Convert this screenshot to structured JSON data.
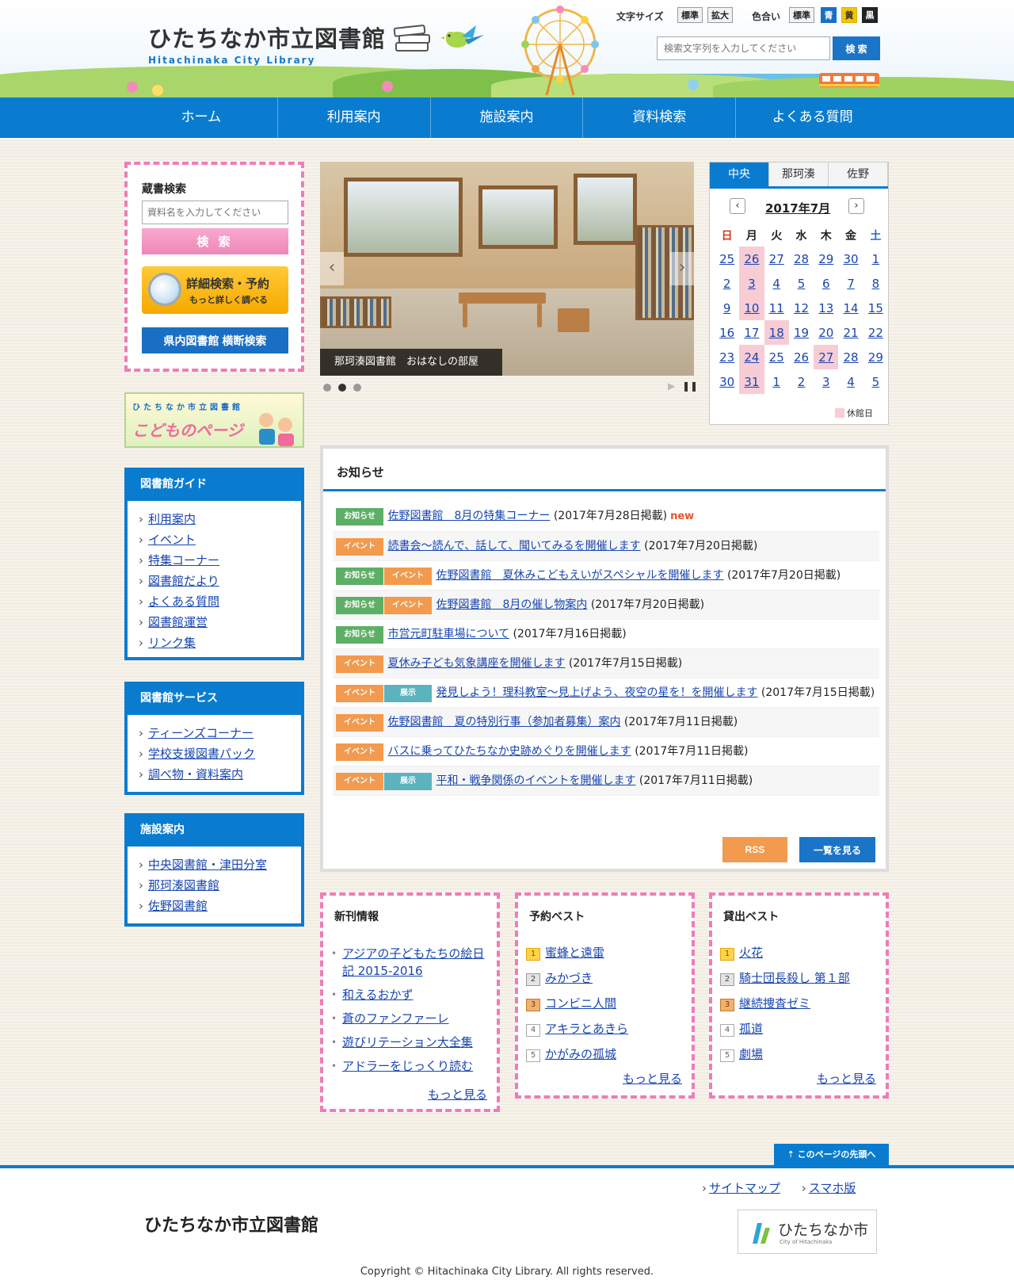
{
  "header": {
    "title": "ひたちなか市立図書館",
    "subtitle": "Hitachinaka City Library",
    "font_size_label": "文字サイズ",
    "font_size_options": [
      "標準",
      "拡大"
    ],
    "color_label": "色合い",
    "color_options": [
      "標準",
      "青",
      "黄",
      "黒"
    ],
    "search_placeholder": "検索文字列を入力してください",
    "search_button": "検 索"
  },
  "nav": {
    "items": [
      "ホーム",
      "利用案内",
      "施設案内",
      "資料検索",
      "よくある質問"
    ]
  },
  "catalog": {
    "heading": "蔵書検索",
    "placeholder": "資料名を入力してください",
    "search_button": "検 索",
    "detail_title": "詳細検索・予約",
    "detail_sub": "もっと詳しく調べる",
    "pref_button": "県内図書館 横断検索"
  },
  "kids_banner": {
    "line1": "ひたちなか市立図書館",
    "line2": "こどものページ"
  },
  "guide": {
    "heading": "図書館ガイド",
    "items": [
      "利用案内",
      "イベント",
      "特集コーナー",
      "図書館だより",
      "よくある質問",
      "図書館運営",
      "リンク集"
    ]
  },
  "services": {
    "heading": "図書館サービス",
    "items": [
      "ティーンズコーナー",
      "学校支援図書パック",
      "調べ物・資料案内"
    ]
  },
  "facilities": {
    "heading": "施設案内",
    "items": [
      "中央図書館・津田分室",
      "那珂湊図書館",
      "佐野図書館"
    ]
  },
  "slideshow": {
    "caption": "那珂湊図書館　おはなしの部屋",
    "prev": "‹",
    "next": "›",
    "play": "▶",
    "pause": "❚❚"
  },
  "calendar": {
    "tabs": [
      "中央",
      "那珂湊",
      "佐野"
    ],
    "month": "2017年7月",
    "prev": "‹",
    "next": "›",
    "weekdays": [
      "日",
      "月",
      "火",
      "水",
      "木",
      "金",
      "土"
    ],
    "weeks": [
      [
        "25",
        "26",
        "27",
        "28",
        "29",
        "30",
        "1"
      ],
      [
        "2",
        "3",
        "4",
        "5",
        "6",
        "7",
        "8"
      ],
      [
        "9",
        "10",
        "11",
        "12",
        "13",
        "14",
        "15"
      ],
      [
        "16",
        "17",
        "18",
        "19",
        "20",
        "21",
        "22"
      ],
      [
        "23",
        "24",
        "25",
        "26",
        "27",
        "28",
        "29"
      ],
      [
        "30",
        "31",
        "1",
        "2",
        "3",
        "4",
        "5"
      ]
    ],
    "closed": [
      "0-1",
      "1-1",
      "2-1",
      "3-2",
      "4-1",
      "4-4",
      "5-1"
    ],
    "legend": "休館日",
    "colors": {
      "sunday": "#d9381e",
      "saturday": "#1a6fc4",
      "closed": "#f8ccd5"
    }
  },
  "news": {
    "heading": "お知らせ",
    "items": [
      {
        "tags": [
          "お知らせ"
        ],
        "title": "佐野図書館　8月の特集コーナー",
        "date": "(2017年7月28日掲載)",
        "new": "new"
      },
      {
        "tags": [
          "イベント"
        ],
        "title": "読書会～読んで、話して、聞いてみるを開催します",
        "date": "(2017年7月20日掲載)"
      },
      {
        "tags": [
          "お知らせ",
          "イベント"
        ],
        "title": "佐野図書館　夏休みこどもえいがスペシャルを開催します",
        "date": "(2017年7月20日掲載)"
      },
      {
        "tags": [
          "お知らせ",
          "イベント"
        ],
        "title": "佐野図書館　8月の催し物案内",
        "date": "(2017年7月20日掲載)"
      },
      {
        "tags": [
          "お知らせ"
        ],
        "title": "市営元町駐車場について",
        "date": "(2017年7月16日掲載)"
      },
      {
        "tags": [
          "イベント"
        ],
        "title": "夏休み子ども気象講座を開催します",
        "date": "(2017年7月15日掲載)"
      },
      {
        "tags": [
          "イベント",
          "展示"
        ],
        "title": "発見しよう！理科教室～見上げよう、夜空の星を！を開催します",
        "date": "(2017年7月15日掲載)"
      },
      {
        "tags": [
          "イベント"
        ],
        "title": "佐野図書館　夏の特別行事（参加者募集）案内",
        "date": "(2017年7月11日掲載)"
      },
      {
        "tags": [
          "イベント"
        ],
        "title": "バスに乗ってひたちなか史跡めぐりを開催します",
        "date": "(2017年7月11日掲載)"
      },
      {
        "tags": [
          "イベント",
          "展示"
        ],
        "title": "平和・戦争関係のイベントを開催します",
        "date": "(2017年7月11日掲載)"
      }
    ],
    "rss_button": "RSS",
    "list_button": "一覧を見る"
  },
  "new_books": {
    "heading": "新刊情報",
    "items": [
      "アジアの子どもたちの絵日記 2015-2016",
      "和えるおかず",
      "蒼のファンファーレ",
      "遊びリテーション大全集",
      "アドラーをじっくり読む"
    ],
    "more": "もっと見る"
  },
  "reserve_best": {
    "heading": "予約ベスト",
    "items": [
      "蜜蜂と遠雷",
      "みかづき",
      "コンビニ人間",
      "アキラとあきら",
      "かがみの孤城"
    ],
    "ranks": [
      "1",
      "2",
      "3",
      "4",
      "5"
    ],
    "more": "もっと見る"
  },
  "lend_best": {
    "heading": "貸出ベスト",
    "items": [
      "火花",
      "騎士団長殺し 第１部",
      "継続捜査ゼミ",
      "孤道",
      "劇場"
    ],
    "ranks": [
      "1",
      "2",
      "3",
      "4",
      "5"
    ],
    "more": "もっと見る"
  },
  "footer": {
    "page_top": "このページの先頭へ",
    "links": [
      "サイトマップ",
      "スマホ版"
    ],
    "library_name": "ひたちなか市立図書館",
    "city_logo_name": "ひたちなか市",
    "city_logo_en": "City of Hitachinaka",
    "copyright": "Copyright © Hitachinaka City Library. All rights reserved."
  },
  "colors": {
    "brand_blue": "#0a7cd0",
    "pink_border": "#ef7cb8",
    "tag_notice": "#5eaf66",
    "tag_event": "#f29a4e",
    "tag_exhibit": "#5cb2bd"
  }
}
